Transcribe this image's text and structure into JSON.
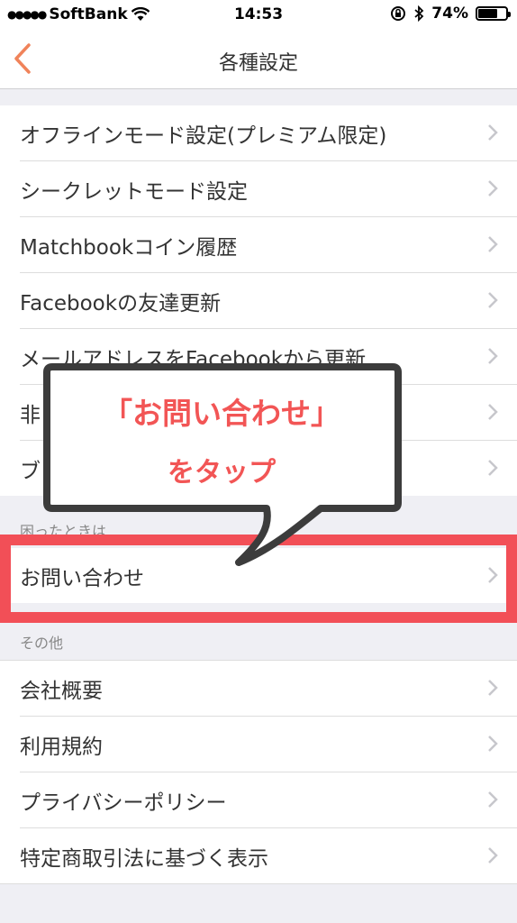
{
  "status": {
    "carrier": "SoftBank",
    "time": "14:53",
    "battery": "74%",
    "battery_level": 0.74
  },
  "nav": {
    "title": "各種設定"
  },
  "settings_group": [
    "オフラインモード設定(プレミアム限定)",
    "シークレットモード設定",
    "Matchbookコイン履歴",
    "Facebookの友達更新",
    "メールアドレスをFacebookから更新",
    "非",
    "ブ"
  ],
  "help": {
    "header": "困ったときは",
    "items": [
      "お問い合わせ"
    ]
  },
  "other": {
    "header": "その他",
    "items": [
      "会社概要",
      "利用規約",
      "プライバシーポリシー",
      "特定商取引法に基づく表示"
    ]
  },
  "callout": {
    "line1": "「お問い合わせ」",
    "line2": "をタップ"
  },
  "colors": {
    "accent": "#f0835a",
    "highlight": "#f24f57",
    "callout_text": "#f25555"
  }
}
